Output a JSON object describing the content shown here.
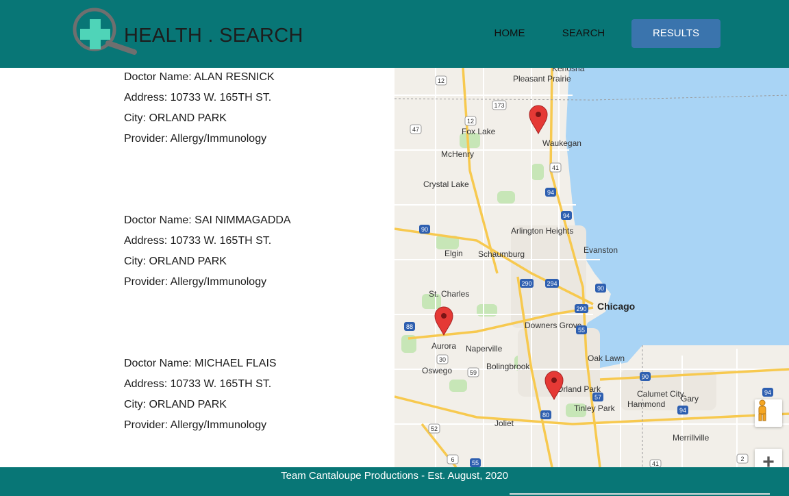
{
  "header": {
    "brand": "HEALTH . SEARCH",
    "nav": {
      "home": "HOME",
      "search": "SEARCH",
      "results": "RESULTS"
    }
  },
  "results": [
    {
      "name_label": "Doctor Name: ALAN RESNICK",
      "address_label": "Address: 10733 W. 165TH ST.",
      "city_label": "City: ORLAND PARK",
      "provider_label": "Provider: Allergy/Immunology"
    },
    {
      "name_label": "Doctor Name: SAI NIMMAGADDA",
      "address_label": "Address: 10733 W. 165TH ST.",
      "city_label": "City: ORLAND PARK",
      "provider_label": "Provider: Allergy/Immunology"
    },
    {
      "name_label": "Doctor Name: MICHAEL FLAIS",
      "address_label": "Address: 10733 W. 165TH ST.",
      "city_label": "City: ORLAND PARK",
      "provider_label": "Provider: Allergy/Immunology"
    }
  ],
  "map": {
    "places": [
      "Kenosha",
      "Pleasant Prairie",
      "Fox Lake",
      "Waukegan",
      "McHenry",
      "Crystal Lake",
      "Arlington Heights",
      "Elgin",
      "Schaumburg",
      "Evanston",
      "St. Charles",
      "Chicago",
      "Downers Grove",
      "Aurora",
      "Naperville",
      "Oak Lawn",
      "Oswego",
      "Bolingbrook",
      "Orland Park",
      "Calumet City",
      "Gary",
      "Hammond",
      "Tinley Park",
      "Joliet",
      "Merrillville"
    ],
    "highways": [
      "12",
      "173",
      "47",
      "12",
      "41",
      "94",
      "94",
      "90",
      "290",
      "294",
      "90",
      "290",
      "88",
      "55",
      "30",
      "59",
      "90",
      "57",
      "94",
      "80",
      "94",
      "52",
      "6",
      "55",
      "41",
      "2"
    ],
    "controls": {
      "zoom_in": "+"
    }
  },
  "colors": {
    "header_bg": "#087676",
    "results_button": "#3a74ad",
    "marker": "#e53935",
    "water": "#a9d4f5",
    "map_land": "#f2efe9"
  },
  "footer": {
    "text": "Team Cantaloupe Productions - Est. August, 2020"
  }
}
